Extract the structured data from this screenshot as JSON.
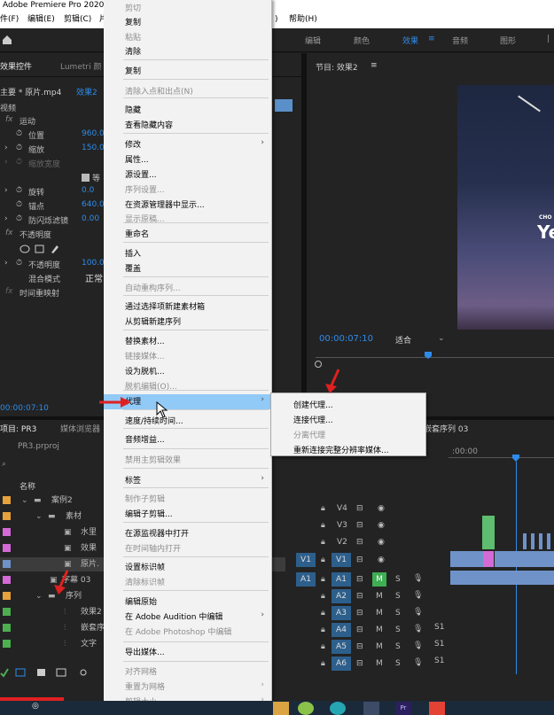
{
  "window": {
    "title": "Adobe Premiere Pro 2020"
  },
  "menubar": {
    "file": "件(F)",
    "edit": "编辑(E)",
    "clip": "剪辑(C)",
    "partial_menu": "片",
    "partial_menu2": ")",
    "help": "帮助(H)"
  },
  "workspaces": {
    "edit": "编辑",
    "color": "颜色",
    "effects": "效果",
    "audio": "音频",
    "graphics": "图形"
  },
  "effect_controls": {
    "tab": "效果控件",
    "tab2": "Lumetri 颜",
    "source": "主要 * 原片.mp4",
    "sequence": "效果2",
    "video_label": "视频",
    "motion": "运动",
    "position": "位置",
    "position_val": "960.0",
    "scale": "缩放",
    "scale_val": "150.0",
    "scale_width": "缩放宽度",
    "uniform": "等",
    "rotation": "旋转",
    "rotation_val": "0.0",
    "anchor": "锚点",
    "anchor_val": "640.0",
    "anti_flicker": "防闪烁滤镜",
    "anti_flicker_val": "0.00",
    "opacity_group": "不透明度",
    "opacity": "不透明度",
    "opacity_val": "100.0",
    "blend": "混合模式",
    "blend_val": "正常",
    "time_remap": "时间重映射",
    "timecode": "00:00:07:10"
  },
  "program": {
    "title": "节目: 效果2",
    "timecode": "00:00:07:10",
    "fit": "适合",
    "video_text_small": "CHO",
    "video_text_big": "Ye"
  },
  "project": {
    "tab": "项目: PR3",
    "tab2": "媒体浏览器",
    "file": "PR3.prproj",
    "name_header": "名称",
    "items": [
      {
        "label": "案例2",
        "color": "#e8a23c"
      },
      {
        "label": "素材",
        "color": "#e8a23c"
      },
      {
        "label": "水里",
        "color": "#d46ad6"
      },
      {
        "label": "效果",
        "color": "#d46ad6"
      },
      {
        "label": "原片.",
        "color": "#6f93c9"
      },
      {
        "label": "字幕 03",
        "color": "#d46ad6"
      },
      {
        "label": "序列",
        "color": "#e8a23c"
      },
      {
        "label": "效果2",
        "color": "#4caf50"
      },
      {
        "label": "嵌套序列",
        "color": "#4caf50"
      },
      {
        "label": "文字",
        "color": "#4caf50"
      }
    ]
  },
  "timeline": {
    "tab": "嵌套序列 03",
    "time_label": ":00:00",
    "video_tracks": [
      "V4",
      "V3",
      "V2",
      "V1"
    ],
    "audio_tracks": [
      "A1",
      "A2",
      "A3",
      "A4",
      "A5",
      "A6"
    ],
    "source_v": "V1",
    "source_a": "A1",
    "mute": "M",
    "solo": "S",
    "level_s": "S1"
  },
  "context_menu": {
    "items": [
      {
        "label": "剪切",
        "disabled": true
      },
      {
        "label": "复制",
        "disabled": false
      },
      {
        "label": "粘贴",
        "disabled": true
      },
      {
        "label": "清除",
        "disabled": false
      },
      {
        "label": "复制",
        "disabled": false
      },
      {
        "label": "清除入点和出点(N)",
        "disabled": true
      },
      {
        "label": "隐藏",
        "disabled": false
      },
      {
        "label": "查看隐藏内容",
        "disabled": false
      },
      {
        "label": "修改",
        "disabled": false,
        "submenu": true
      },
      {
        "label": "属性...",
        "disabled": false
      },
      {
        "label": "源设置...",
        "disabled": false
      },
      {
        "label": "序列设置...",
        "disabled": true
      },
      {
        "label": "在资源管理器中显示...",
        "disabled": false
      },
      {
        "label": "显示原稿...",
        "disabled": true
      },
      {
        "label": "重命名",
        "disabled": false
      },
      {
        "label": "插入",
        "disabled": false
      },
      {
        "label": "覆盖",
        "disabled": false
      },
      {
        "label": "自动重构序列...",
        "disabled": true
      },
      {
        "label": "通过选择项新建素材箱",
        "disabled": false
      },
      {
        "label": "从剪辑新建序列",
        "disabled": false
      },
      {
        "label": "替换素材...",
        "disabled": false
      },
      {
        "label": "链接媒体...",
        "disabled": true
      },
      {
        "label": "设为脱机...",
        "disabled": false
      },
      {
        "label": "脱机编辑(O)...",
        "disabled": true
      },
      {
        "label": "代理",
        "disabled": false,
        "submenu": true,
        "highlighted": true
      },
      {
        "label": "速度/持续时间...",
        "disabled": false
      },
      {
        "label": "音频增益...",
        "disabled": false
      },
      {
        "label": "禁用主剪辑效果",
        "disabled": true
      },
      {
        "label": "标签",
        "disabled": false,
        "submenu": true
      },
      {
        "label": "制作子剪辑",
        "disabled": true
      },
      {
        "label": "编辑子剪辑...",
        "disabled": false
      },
      {
        "label": "在源监视器中打开",
        "disabled": false
      },
      {
        "label": "在时间轴内打开",
        "disabled": true
      },
      {
        "label": "设置标识帧",
        "disabled": false
      },
      {
        "label": "清除标识帧",
        "disabled": true
      },
      {
        "label": "编辑原始",
        "disabled": false
      },
      {
        "label": "在 Adobe Audition 中编辑",
        "disabled": false,
        "submenu": true
      },
      {
        "label": "在 Adobe Photoshop 中编辑",
        "disabled": true
      },
      {
        "label": "导出媒体...",
        "disabled": false
      },
      {
        "label": "对齐网格",
        "disabled": true
      },
      {
        "label": "重置为网格",
        "disabled": true,
        "submenu": true
      },
      {
        "label": "剪辑大小",
        "disabled": true,
        "submenu": true
      }
    ]
  },
  "proxy_submenu": {
    "items": [
      {
        "label": "创建代理...",
        "disabled": false
      },
      {
        "label": "连接代理...",
        "disabled": false
      },
      {
        "label": "分离代理",
        "disabled": true
      },
      {
        "label": "重新连接完整分辨率媒体...",
        "disabled": false
      }
    ]
  },
  "colors": {
    "accent_blue": "#2d8ceb",
    "highlight": "#91c9f7",
    "arrow_red": "#e02020"
  }
}
